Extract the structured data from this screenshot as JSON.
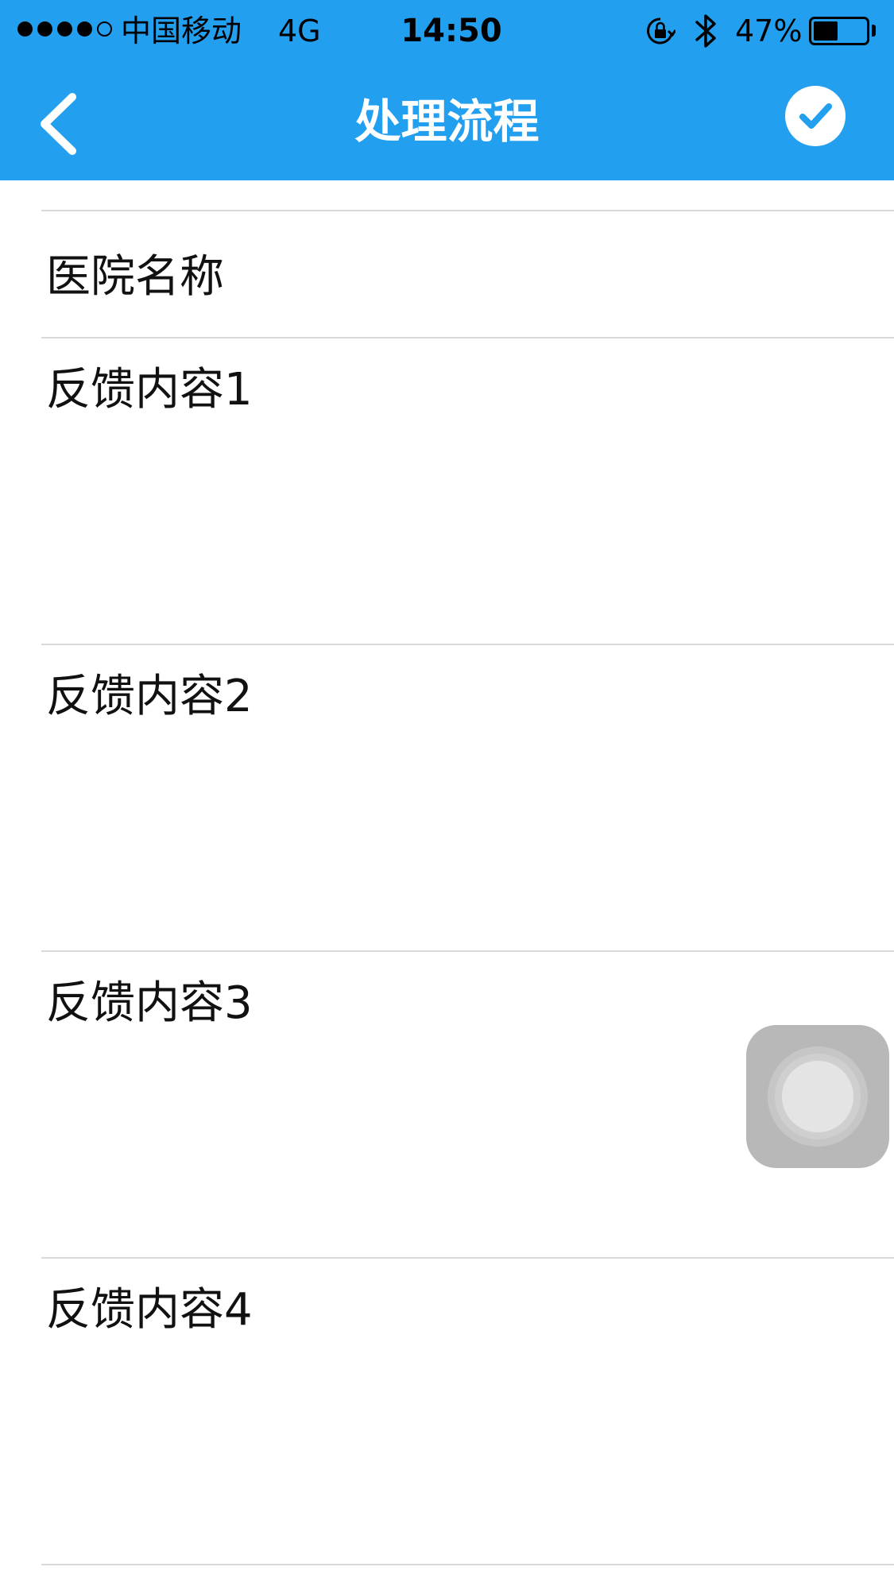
{
  "status_bar": {
    "signal_dots": [
      true,
      true,
      true,
      true,
      false
    ],
    "carrier": "中国移动",
    "network": "4G",
    "time": "14:50",
    "battery_percent": "47%",
    "battery_level": 0.47,
    "icons": [
      "orientation-lock-icon",
      "bluetooth-icon",
      "battery-icon"
    ]
  },
  "nav": {
    "back_icon": "chevron-left-icon",
    "title": "处理流程",
    "confirm_icon": "checkmark-circle-icon"
  },
  "form": {
    "rows": [
      {
        "label": "医院名称"
      },
      {
        "label": "反馈内容1"
      },
      {
        "label": "反馈内容2"
      },
      {
        "label": "反馈内容3"
      },
      {
        "label": "反馈内容4"
      }
    ]
  },
  "overlay": {
    "assistive_touch_icon": "assistive-touch-icon"
  },
  "colors": {
    "accent": "#239ff0",
    "divider": "#d9d9d9",
    "text": "#111111",
    "background": "#ffffff"
  }
}
